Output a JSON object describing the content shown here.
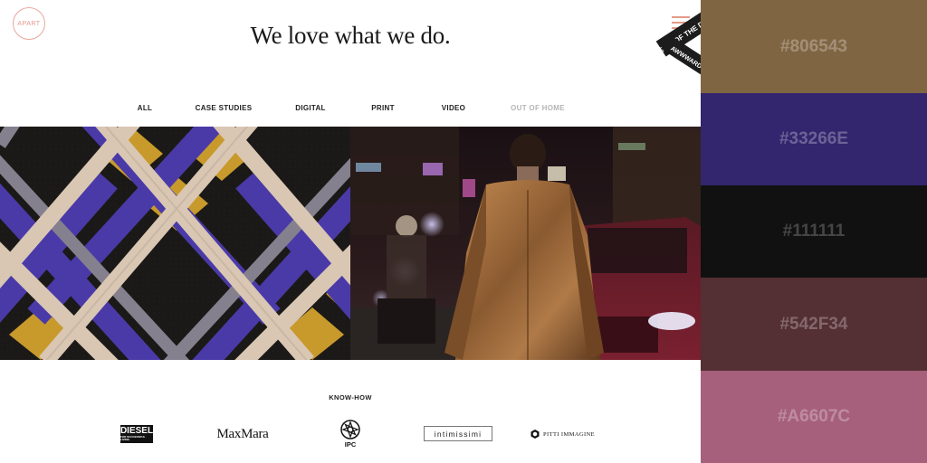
{
  "site": {
    "logo_text": "APART",
    "headline": "We love what we do.",
    "badge": {
      "line1": "SITE OF THE DAY",
      "line2": "AWWWARDS",
      "color": "#1c1c1c"
    },
    "accent": "#e39a8a",
    "filters": [
      {
        "label": "ALL",
        "active": true
      },
      {
        "label": "CASE STUDIES",
        "active": true
      },
      {
        "label": "DIGITAL",
        "active": true
      },
      {
        "label": "PRINT",
        "active": true
      },
      {
        "label": "VIDEO",
        "active": true
      },
      {
        "label": "OUT OF HOME",
        "active": false
      }
    ],
    "knowhow_label": "KNOW-HOW",
    "clients": {
      "diesel": "DIESEL",
      "diesel_tagline": "FOR SUCCESSFUL LIVING",
      "maxmara": "MaxMara",
      "ipc": "IPC",
      "intimissimi": "intimissimi",
      "pitti": "PITTI IMMAGINE"
    }
  },
  "palette": [
    {
      "label": "#806543",
      "color": "#806543"
    },
    {
      "label": "#33266E",
      "color": "#33266E"
    },
    {
      "label": "#111111",
      "color": "#111111"
    },
    {
      "label": "#542F34",
      "color": "#542F34"
    },
    {
      "label": "#A6607C",
      "color": "#A6607C"
    }
  ]
}
